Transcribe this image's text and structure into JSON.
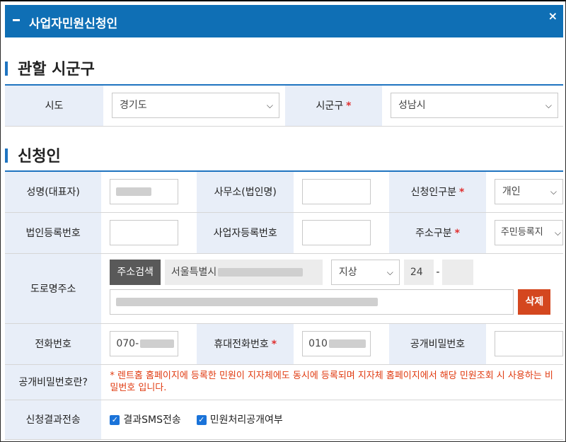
{
  "header": {
    "title": "사업자민원신청인",
    "close_icon": "×"
  },
  "jurisdiction": {
    "section_title": "관할 시군구",
    "sido_label": "시도",
    "sido_value": "경기도",
    "sigungu_label": "시군구",
    "sigungu_value": "성남시",
    "required_mark": "*"
  },
  "applicant": {
    "section_title": "신청인",
    "name_label": "성명(대표자)",
    "office_label": "사무소(법인명)",
    "applicant_type_label": "신청인구분",
    "applicant_type_value": "개인",
    "corp_reg_label": "법인등록번호",
    "biz_reg_label": "사업자등록번호",
    "address_type_label": "주소구분",
    "address_type_value": "주민등록지",
    "road_address_label": "도로명주소",
    "address_search_button": "주소검색",
    "address_value": "서울특별시",
    "floor_type_value": "지상",
    "floor_number": "24",
    "dash": "-",
    "delete_button": "삭제",
    "phone_label": "전화번호",
    "phone_value": "070-",
    "mobile_label": "휴대전화번호",
    "mobile_value": "010",
    "password_label": "공개비밀번호",
    "password_info_label": "공개비밀번호란?",
    "password_info_text": "* 렌트홈 홈페이지에 등록한 민원이 지자체에도 동시에 등록되며 지자체 홈페이지에서 해당 민원조회 시 사용하는 비밀번호 입니다.",
    "result_label": "신청결과전송",
    "sms_checkbox_label": "결과SMS전송",
    "public_checkbox_label": "민원처리공개여부",
    "check_mark": "✓",
    "chevron": "⌵"
  },
  "colors": {
    "header_bg": "#0f6fb5",
    "accent_bar": "#1f74c0",
    "label_bg": "#e8eef8",
    "required": "#e03030",
    "delete_btn": "#d4471f",
    "notice": "#e03a10"
  }
}
